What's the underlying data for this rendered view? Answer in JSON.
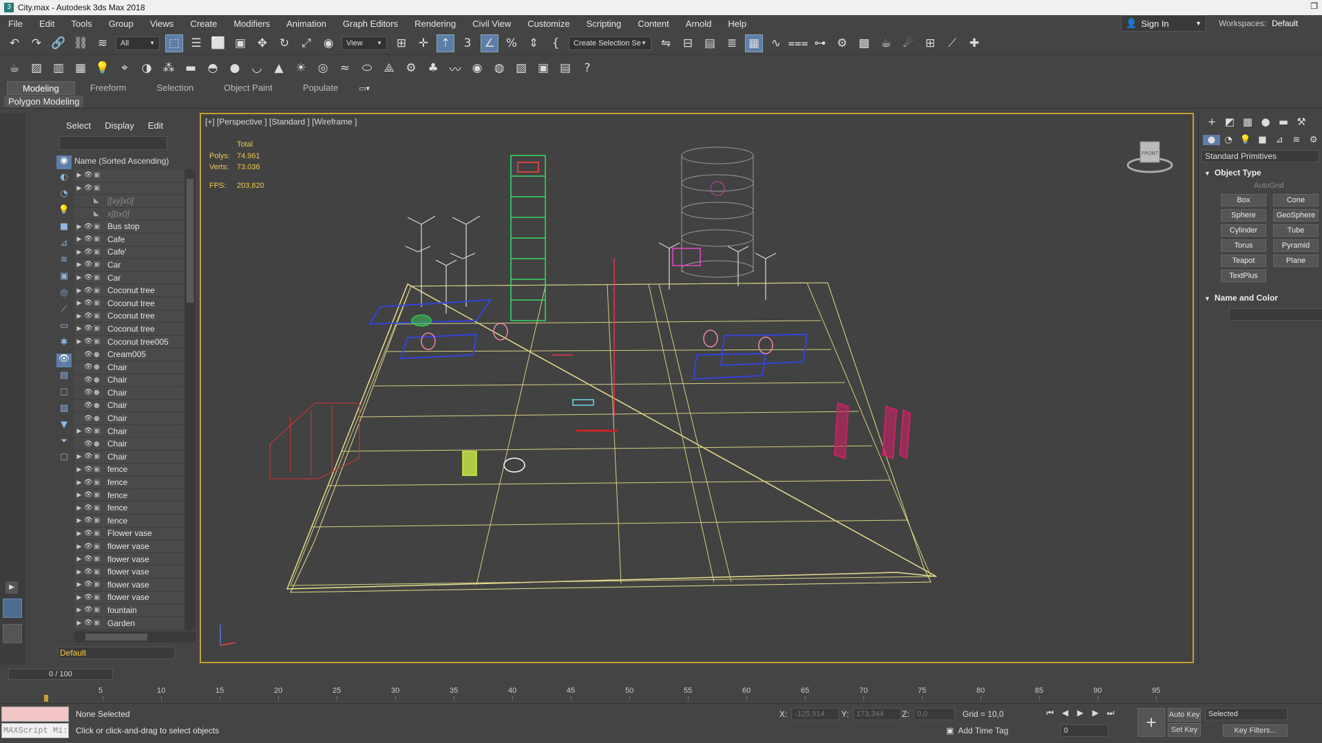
{
  "window": {
    "title": "City.max - Autodesk 3ds Max 2018"
  },
  "menu": [
    "File",
    "Edit",
    "Tools",
    "Group",
    "Views",
    "Create",
    "Modifiers",
    "Animation",
    "Graph Editors",
    "Rendering",
    "Civil View",
    "Customize",
    "Scripting",
    "Content",
    "Arnold",
    "Help"
  ],
  "account": {
    "signin": "Sign In",
    "workspaces_label": "Workspaces:",
    "workspace_value": "Default"
  },
  "toolbar": {
    "filter": "All",
    "ref_coord": "View",
    "selection_set": "Create Selection Se"
  },
  "ribbon": {
    "tabs": [
      "Modeling",
      "Freeform",
      "Selection",
      "Object Paint",
      "Populate"
    ],
    "panel": "Polygon Modeling"
  },
  "explorer": {
    "tabs": [
      "Select",
      "Display",
      "Edit"
    ],
    "column_header": "Name (Sorted Ascending)",
    "rows": [
      {
        "label": "",
        "dim": false,
        "arrow": true
      },
      {
        "label": "",
        "dim": false,
        "arrow": true
      },
      {
        "label": "[[xy]x0]",
        "dim": true,
        "arrow": false
      },
      {
        "label": "x[bx0]",
        "dim": true,
        "arrow": false
      },
      {
        "label": "Bus stop",
        "dim": false,
        "arrow": true
      },
      {
        "label": "Cafe",
        "dim": false,
        "arrow": true
      },
      {
        "label": "Cafe'",
        "dim": false,
        "arrow": true
      },
      {
        "label": "Car",
        "dim": false,
        "arrow": true
      },
      {
        "label": "Car",
        "dim": false,
        "arrow": true
      },
      {
        "label": "Coconut tree",
        "dim": false,
        "arrow": true
      },
      {
        "label": "Coconut tree",
        "dim": false,
        "arrow": true
      },
      {
        "label": "Coconut tree",
        "dim": false,
        "arrow": true
      },
      {
        "label": "Coconut tree",
        "dim": false,
        "arrow": true
      },
      {
        "label": "Coconut tree005",
        "dim": false,
        "arrow": true
      },
      {
        "label": "Cream005",
        "dim": false,
        "arrow": false
      },
      {
        "label": "Chair",
        "dim": false,
        "arrow": false
      },
      {
        "label": "Chair",
        "dim": false,
        "arrow": false
      },
      {
        "label": "Chair",
        "dim": false,
        "arrow": false
      },
      {
        "label": "Chair",
        "dim": false,
        "arrow": false
      },
      {
        "label": "Chair",
        "dim": false,
        "arrow": false
      },
      {
        "label": "Chair",
        "dim": false,
        "arrow": true
      },
      {
        "label": "Chair",
        "dim": false,
        "arrow": false
      },
      {
        "label": "Chair",
        "dim": false,
        "arrow": true
      },
      {
        "label": "fence",
        "dim": false,
        "arrow": true
      },
      {
        "label": "fence",
        "dim": false,
        "arrow": true
      },
      {
        "label": "fence",
        "dim": false,
        "arrow": true
      },
      {
        "label": "fence",
        "dim": false,
        "arrow": true
      },
      {
        "label": "fence",
        "dim": false,
        "arrow": true
      },
      {
        "label": "Flower vase",
        "dim": false,
        "arrow": true
      },
      {
        "label": "flower vase",
        "dim": false,
        "arrow": true
      },
      {
        "label": "flower vase",
        "dim": false,
        "arrow": true
      },
      {
        "label": "flower vase",
        "dim": false,
        "arrow": true
      },
      {
        "label": "flower vase",
        "dim": false,
        "arrow": true
      },
      {
        "label": "flower vase",
        "dim": false,
        "arrow": true
      },
      {
        "label": "fountain",
        "dim": false,
        "arrow": true
      },
      {
        "label": "Garden",
        "dim": false,
        "arrow": true
      }
    ],
    "layer": "Default"
  },
  "viewport": {
    "label": "[+] [Perspective ] [Standard ] [Wireframe ]",
    "stats_total": "Total",
    "polys_label": "Polys:",
    "polys": "74.961",
    "verts_label": "Verts:",
    "verts": "73.036",
    "fps_label": "FPS:",
    "fps": "203,820",
    "viewcube_label": "FRONT"
  },
  "command_panel": {
    "category": "Standard Primitives",
    "object_type": "Object Type",
    "autogrid": "AutoGrid",
    "buttons": [
      "Box",
      "Cone",
      "Sphere",
      "GeoSphere",
      "Cylinder",
      "Tube",
      "Torus",
      "Pyramid",
      "Teapot",
      "Plane",
      "TextPlus"
    ],
    "name_and_color": "Name and Color"
  },
  "timeline": {
    "frame": "0 / 100",
    "ticks": [
      "5",
      "10",
      "15",
      "20",
      "25",
      "30",
      "35",
      "40",
      "45",
      "50",
      "55",
      "60",
      "65",
      "70",
      "75",
      "80",
      "85",
      "90",
      "95"
    ]
  },
  "status": {
    "selection": "None Selected",
    "prompt": "Click or click-and-drag to select objects",
    "maxscript": "MAXScript Mi:",
    "x_label": "X:",
    "x": "-125,914",
    "y_label": "Y:",
    "y": "173,344",
    "z_label": "Z:",
    "z": "0,0",
    "grid": "Grid = 10,0",
    "add_time_tag": "Add Time Tag",
    "current_frame": "0",
    "auto_key": "Auto Key",
    "set_key": "Set Key",
    "key_mode": "Selected",
    "key_filters": "Key Filters..."
  },
  "colors": {
    "accent": "#c8a030",
    "selection_blue": "#5d7ea8",
    "stats_yellow": "#f0c850"
  }
}
